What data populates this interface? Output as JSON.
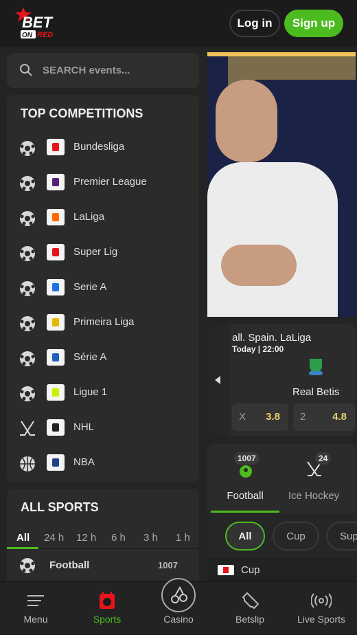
{
  "header": {
    "logo_text": "BET ON RED",
    "login": "Log in",
    "signup": "Sign up"
  },
  "search": {
    "placeholder": "SEARCH events..."
  },
  "top_competitions": {
    "title": "TOP COMPETITIONS",
    "items": [
      {
        "label": "Bundesliga",
        "sport": "football"
      },
      {
        "label": "Premier League",
        "sport": "football"
      },
      {
        "label": "LaLiga",
        "sport": "football"
      },
      {
        "label": "Super Lig",
        "sport": "football"
      },
      {
        "label": "Serie A",
        "sport": "football"
      },
      {
        "label": "Primeira Liga",
        "sport": "football"
      },
      {
        "label": "Série A",
        "sport": "football"
      },
      {
        "label": "Ligue 1",
        "sport": "football"
      },
      {
        "label": "NHL",
        "sport": "ice-hockey"
      },
      {
        "label": "NBA",
        "sport": "basketball"
      }
    ]
  },
  "all_sports": {
    "title": "ALL SPORTS",
    "filters": [
      "All",
      "24 h",
      "12 h",
      "6 h",
      "3 h",
      "1 h"
    ],
    "active_filter": "All",
    "rows": [
      {
        "label": "Football",
        "count": "1007"
      }
    ]
  },
  "match": {
    "league": "all. Spain. LaLiga",
    "time": "Today",
    "clock": "22:00",
    "team": "Real Betis",
    "odds": [
      {
        "k": "X",
        "v": "3.8"
      },
      {
        "k": "2",
        "v": "4.8"
      }
    ]
  },
  "sport_tabs": [
    {
      "label": "Football",
      "count": "1007",
      "active": true
    },
    {
      "label": "Ice Hockey",
      "count": "24"
    }
  ],
  "category_pills": [
    "All",
    "Cup",
    "Sup"
  ],
  "category_row": {
    "label": "Cup"
  },
  "bottom_nav": [
    {
      "label": "Menu",
      "icon": "menu-icon"
    },
    {
      "label": "Sports",
      "icon": "sports-calendar-icon",
      "active": true
    },
    {
      "label": "Casino",
      "icon": "cherry-icon"
    },
    {
      "label": "Betslip",
      "icon": "ticket-icon"
    },
    {
      "label": "Live Sports",
      "icon": "broadcast-icon"
    }
  ],
  "colors": {
    "accent": "#4cbb1f",
    "brand_red": "#e8141b",
    "odds": "#e6cf6c"
  }
}
